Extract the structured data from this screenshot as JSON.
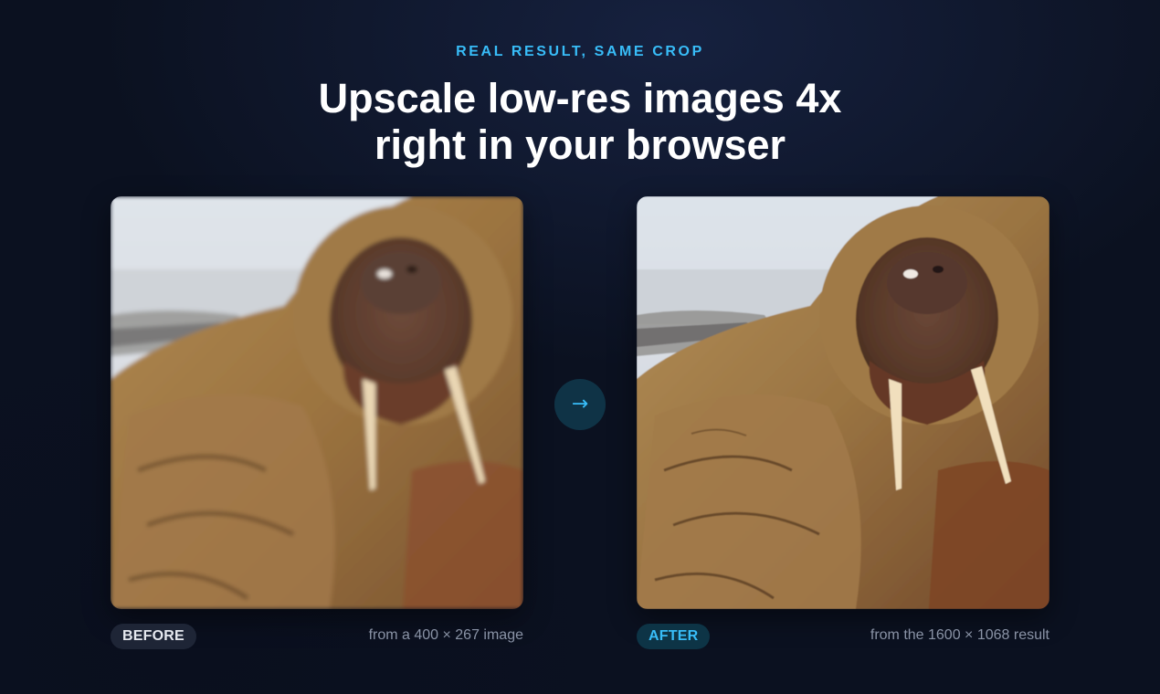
{
  "hero": {
    "eyebrow": "REAL RESULT, SAME CROP",
    "headline_line1": "Upscale low-res images 4x",
    "headline_line2": "right in your browser"
  },
  "comparison": {
    "arrow_icon": "→",
    "before": {
      "badge": "BEFORE",
      "caption": "from a 400 × 267 image",
      "image_subject": "walrus-face-lowres"
    },
    "after": {
      "badge": "AFTER",
      "caption": "from the 1600 × 1068 result",
      "image_subject": "walrus-face-upscaled"
    }
  },
  "colors": {
    "accent": "#38bdf8",
    "background": "#0b1120",
    "badge_before_bg": "#1e2536",
    "badge_after_bg": "#0d3446",
    "caption": "#8a93a6"
  }
}
